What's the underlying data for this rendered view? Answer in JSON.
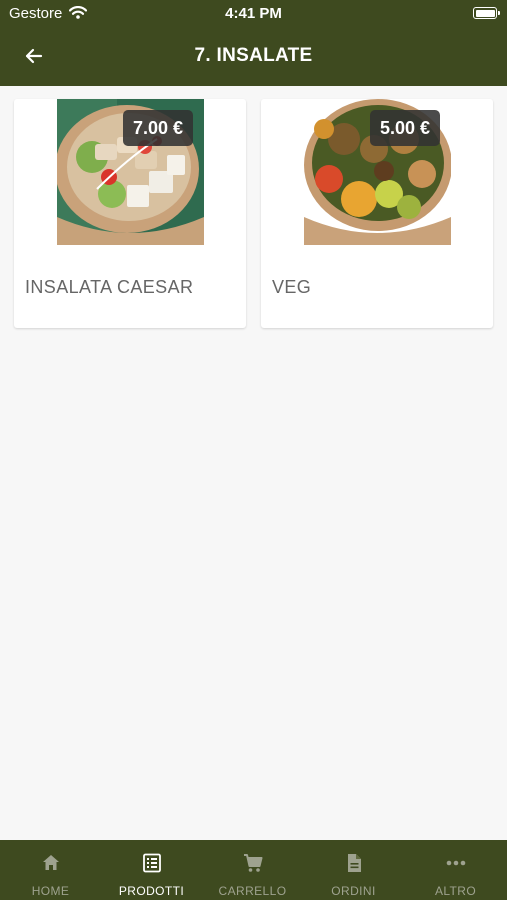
{
  "status_bar": {
    "carrier": "Gestore",
    "time": "4:41 PM"
  },
  "header": {
    "title": "7. INSALATE",
    "back_icon": "arrow-left-icon"
  },
  "products": [
    {
      "name": "INSALATA CAESAR",
      "price": "7.00 €"
    },
    {
      "name": "VEG",
      "price": "5.00 €"
    }
  ],
  "tabs": [
    {
      "label": "HOME",
      "icon": "home-icon"
    },
    {
      "label": "PRODOTTI",
      "icon": "list-icon"
    },
    {
      "label": "CARRELLO",
      "icon": "cart-icon"
    },
    {
      "label": "ORDINI",
      "icon": "document-icon"
    },
    {
      "label": "ALTRO",
      "icon": "more-icon"
    }
  ],
  "active_tab": "PRODOTTI",
  "colors": {
    "header_bg": "#3e4a1f",
    "tab_inactive": "#9ea28f",
    "tab_active": "#ffffff",
    "price_badge": "#323232"
  }
}
